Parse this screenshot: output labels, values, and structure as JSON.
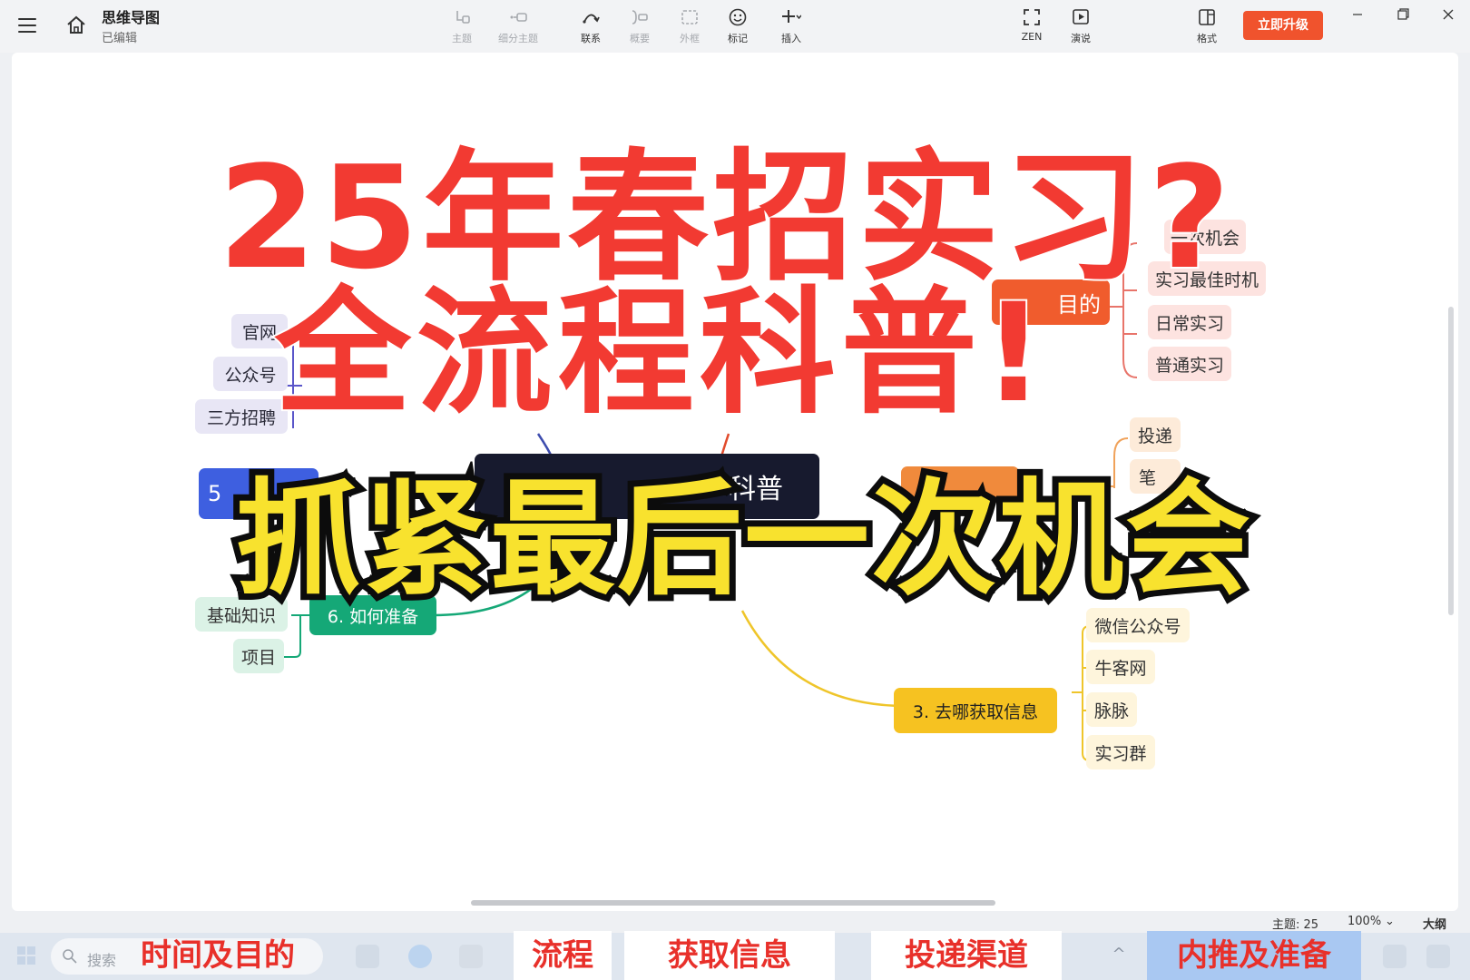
{
  "header": {
    "doc_title": "思维导图",
    "doc_status": "已编辑",
    "tools": [
      {
        "label": "主题",
        "icon": "topic-icon",
        "enabled": false
      },
      {
        "label": "细分主题",
        "icon": "subtopic-icon",
        "enabled": false
      },
      {
        "label": "联系",
        "icon": "relationship-icon",
        "enabled": true
      },
      {
        "label": "概要",
        "icon": "summary-icon",
        "enabled": false
      },
      {
        "label": "外框",
        "icon": "boundary-icon",
        "enabled": false
      },
      {
        "label": "标记",
        "icon": "marker-icon",
        "enabled": true
      },
      {
        "label": "插入",
        "icon": "insert-icon",
        "enabled": true
      },
      {
        "label": "ZEN",
        "icon": "zen-icon",
        "enabled": true
      },
      {
        "label": "演说",
        "icon": "present-icon",
        "enabled": true
      },
      {
        "label": "格式",
        "icon": "format-icon",
        "enabled": true
      }
    ],
    "upgrade_label": "立即升级"
  },
  "mindmap": {
    "root": "科普",
    "branch_1": {
      "label": "目的",
      "children": [
        "一次机会",
        "实习最佳时机",
        "日常实习",
        "普通实习"
      ]
    },
    "branch_2": {
      "children": [
        "投递",
        "笔"
      ]
    },
    "branch_3": {
      "label": "3. 去哪获取信息",
      "children": [
        "微信公众号",
        "牛客网",
        "脉脉",
        "实习群"
      ]
    },
    "branch_5": {
      "label": "5",
      "children": [
        "官网",
        "公众号",
        "三方招聘"
      ]
    },
    "branch_6": {
      "label": "6. 如何准备",
      "children": [
        "基础知识",
        "项目"
      ]
    }
  },
  "overlay": {
    "line1": "25年春招实习?",
    "line2": "全流程科普!",
    "line3": "抓紧最后一次机会"
  },
  "statusbar": {
    "topic_count": "主题: 25",
    "zoom": "100%",
    "outline_label": "大纲"
  },
  "taskbar": {
    "search_placeholder": "搜索",
    "captions": [
      "时间及目的",
      "流程",
      "获取信息",
      "投递渠道",
      "内推及准备"
    ]
  },
  "colors": {
    "upgrade": "#f0532d",
    "overlay_red": "#f23a32",
    "overlay_yellow": "#f8e22e",
    "root_dark": "#171a2e",
    "branch_orange": "#f05c2d",
    "branch_green": "#15a877",
    "branch_yellow": "#f6c221",
    "branch_blue": "#3e5fe0"
  }
}
